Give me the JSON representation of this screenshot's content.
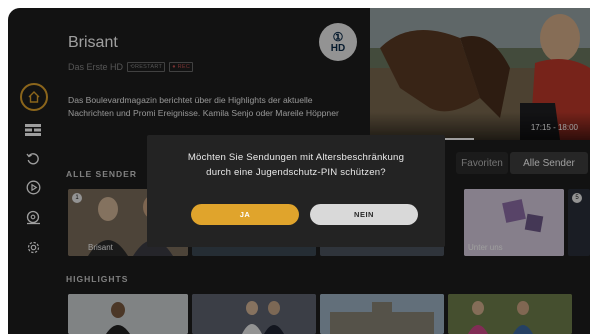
{
  "program": {
    "title": "Brisant",
    "channel": "Das Erste HD",
    "tags": [
      "RESTART",
      "REC"
    ],
    "description": "Das Boulevardmagazin berichtet über die Highlights der aktuelle Nachrichten und Promi Ereignisse. Kamila Senjo oder Mareile Höppner",
    "logo_top": "①",
    "logo_bottom": "HD",
    "time": "17:15 - 18:00"
  },
  "sidebar": {
    "items": [
      "home",
      "guide",
      "replay",
      "play",
      "search",
      "settings"
    ]
  },
  "sections": {
    "channels": "ALLE SENDER",
    "highlights": "HIGHLIGHTS"
  },
  "filter": {
    "favorites": "Favoriten",
    "all": "Alle Sender"
  },
  "channels": [
    {
      "number": "1",
      "label": "Brisant"
    },
    {
      "number": "",
      "label": ""
    },
    {
      "number": "",
      "label": ""
    },
    {
      "number": "",
      "label": "Unter uns"
    },
    {
      "number": "5",
      "label": ""
    }
  ],
  "dialog": {
    "message": "Möchten Sie Sendungen mit Altersbeschränkung\ndurch eine Jugendschutz-PIN schützen?",
    "yes": "JA",
    "no": "NEIN"
  },
  "colors": {
    "accent": "#e0a42c",
    "background": "#1e1e1e",
    "dialog": "#232323"
  }
}
